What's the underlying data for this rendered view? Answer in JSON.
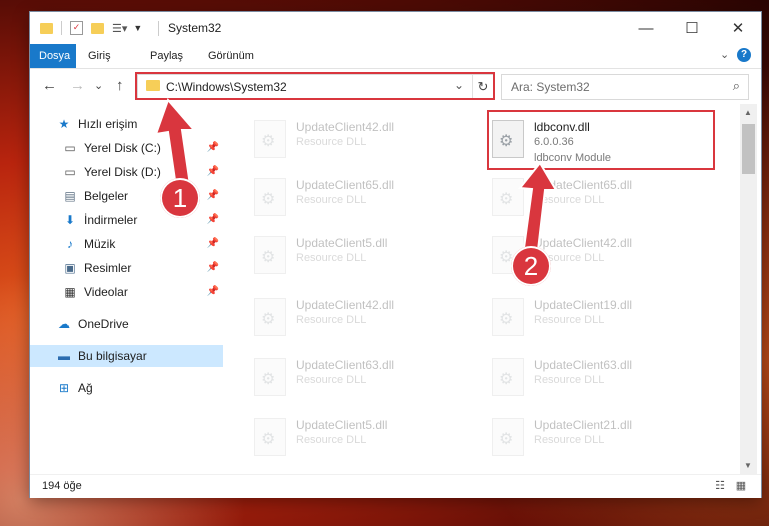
{
  "window": {
    "title": "System32",
    "controls": {
      "minimize": "—",
      "maximize": "☐",
      "close": "✕"
    }
  },
  "ribbon": {
    "tabs": [
      {
        "label": "Dosya",
        "active": true
      },
      {
        "label": "Giriş",
        "active": false
      },
      {
        "label": "Paylaş",
        "active": false
      },
      {
        "label": "Görünüm",
        "active": false
      }
    ],
    "expand": "⌄",
    "help": "?"
  },
  "nav": {
    "back": "←",
    "forward": "→",
    "recent": "⌄",
    "up": "↑",
    "address": "C:\\Windows\\System32",
    "address_dropdown": "⌄",
    "refresh": "↻",
    "search_placeholder": "Ara: System32",
    "search_icon": "⌕"
  },
  "sidebar": {
    "items": [
      {
        "label": "Hızlı erişim",
        "icon": "star-icon",
        "glyph": "★",
        "color": "#1979ca",
        "pinned": false
      },
      {
        "label": "Yerel Disk (C:)",
        "icon": "drive-icon",
        "glyph": "▭",
        "color": "#555555",
        "pinned": true
      },
      {
        "label": "Yerel Disk (D:)",
        "icon": "drive-icon",
        "glyph": "▭",
        "color": "#555555",
        "pinned": true
      },
      {
        "label": "Belgeler",
        "icon": "documents-icon",
        "glyph": "▤",
        "color": "#5c6f82",
        "pinned": true
      },
      {
        "label": "İndirmeler",
        "icon": "download-icon",
        "glyph": "⬇",
        "color": "#1979ca",
        "pinned": true
      },
      {
        "label": "Müzik",
        "icon": "music-icon",
        "glyph": "♪",
        "color": "#1979ca",
        "pinned": true
      },
      {
        "label": "Resimler",
        "icon": "pictures-icon",
        "glyph": "▣",
        "color": "#4a6a8a",
        "pinned": true
      },
      {
        "label": "Videolar",
        "icon": "videos-icon",
        "glyph": "▦",
        "color": "#333333",
        "pinned": true
      },
      {
        "label": "OneDrive",
        "icon": "cloud-icon",
        "glyph": "☁",
        "color": "#1979ca",
        "pinned": false
      },
      {
        "label": "Bu bilgisayar",
        "icon": "computer-icon",
        "glyph": "▬",
        "color": "#2b6cb0",
        "pinned": false,
        "selected": true
      },
      {
        "label": "Ağ",
        "icon": "network-icon",
        "glyph": "⊞",
        "color": "#1979ca",
        "pinned": false
      }
    ],
    "pin_glyph": "📌"
  },
  "files": [
    {
      "name": "UpdateClient42.dll",
      "type": "Resource DLL",
      "faded": true
    },
    {
      "name": "ldbconv.dll",
      "type": "6.0.0.36",
      "desc": "ldbconv Module",
      "faded": false
    },
    {
      "name": "UpdateClient65.dll",
      "type": "Resource DLL",
      "faded": true
    },
    {
      "name": "UpdateClient65.dll",
      "type": "Resource DLL",
      "faded": true
    },
    {
      "name": "UpdateClient5.dll",
      "type": "Resource DLL",
      "faded": true
    },
    {
      "name": "UpdateClient42.dll",
      "type": "Resource DLL",
      "faded": true
    },
    {
      "name": "UpdateClient42.dll",
      "type": "Resource DLL",
      "faded": true
    },
    {
      "name": "UpdateClient19.dll",
      "type": "Resource DLL",
      "faded": true
    },
    {
      "name": "UpdateClient63.dll",
      "type": "Resource DLL",
      "faded": true
    },
    {
      "name": "UpdateClient63.dll",
      "type": "Resource DLL",
      "faded": true
    },
    {
      "name": "UpdateClient5.dll",
      "type": "Resource DLL",
      "faded": true
    },
    {
      "name": "UpdateClient21.dll",
      "type": "Resource DLL",
      "faded": true
    }
  ],
  "status": {
    "count": "194 öğe",
    "view_details": "☷",
    "view_tiles": "▦"
  },
  "annotations": {
    "step1": "1",
    "step2": "2",
    "color": "#d9363e"
  }
}
